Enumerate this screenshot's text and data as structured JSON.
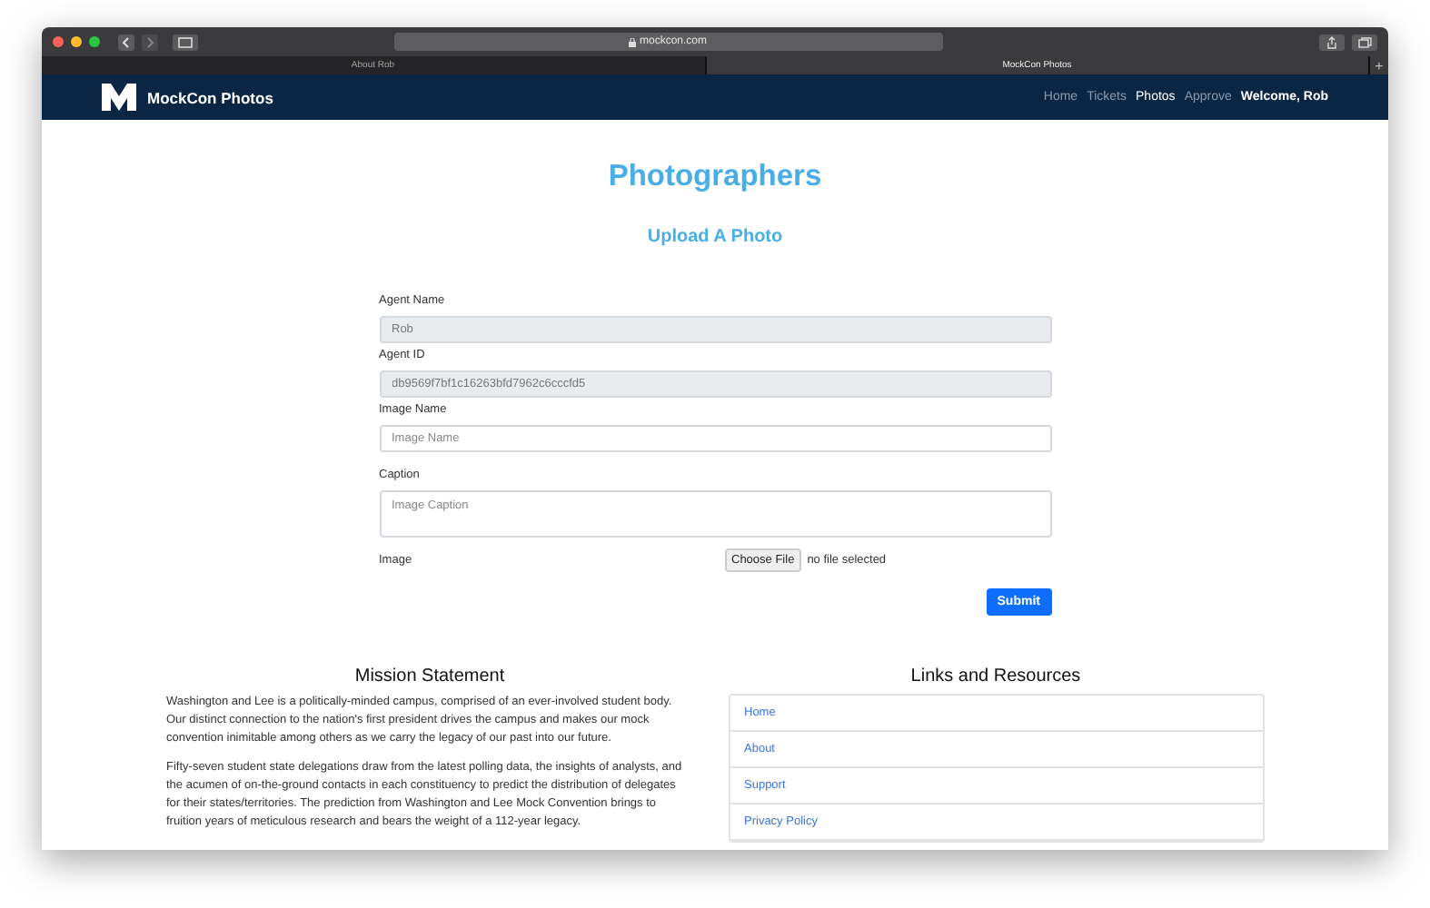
{
  "browser": {
    "url": "mockcon.com",
    "tabs": [
      {
        "label": "About Rob",
        "selected": false
      },
      {
        "label": "MockCon Photos",
        "selected": true
      }
    ],
    "new_tab": "+"
  },
  "navbar": {
    "brand": "MockCon Photos",
    "links": [
      {
        "label": "Home",
        "selected": false
      },
      {
        "label": "Tickets",
        "selected": false
      },
      {
        "label": "Photos",
        "selected": true
      },
      {
        "label": "Approve",
        "selected": false
      }
    ],
    "welcome": "Welcome, Rob"
  },
  "page": {
    "title": "Photographers",
    "subtitle": "Upload A Photo"
  },
  "form": {
    "fields": [
      {
        "kind": "input",
        "label": "Agent Name",
        "value": "Rob",
        "disabled": true
      },
      {
        "kind": "input",
        "label": "Agent ID",
        "value": "db9569f7bf1c16263bfd7962c6cccfd5",
        "disabled": true
      },
      {
        "kind": "input",
        "label": "Image Name",
        "placeholder": "Image Name",
        "disabled": false
      },
      {
        "kind": "textarea",
        "label": "Caption",
        "placeholder": "Image Caption",
        "disabled": false
      },
      {
        "kind": "file",
        "label": "Image",
        "button": "Choose File",
        "status": "no file selected"
      }
    ],
    "submit": "Submit"
  },
  "mission": {
    "title": "Mission Statement",
    "paragraphs": [
      "Washington and Lee is a politically-minded campus, comprised of an ever-involved student body. Our distinct connection to the nation's first president drives the campus and makes our mock convention inimitable among others as we carry the legacy of our past into our future.",
      "Fifty-seven student state delegations draw from the latest polling data, the insights of analysts, and the acumen of on-the-ground contacts in each constituency to predict the distribution of delegates for their states/territories. The prediction from Washington and Lee Mock Convention brings to fruition years of meticulous research and bears the weight of a 112-year legacy."
    ]
  },
  "links": {
    "title": "Links and Resources",
    "items": [
      "Home",
      "About",
      "Support",
      "Privacy Policy"
    ]
  }
}
